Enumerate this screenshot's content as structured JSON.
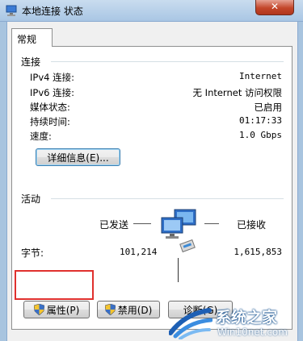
{
  "window": {
    "title": "本地连接 状态",
    "close_label": "✕"
  },
  "tab": {
    "label": "常规"
  },
  "connection": {
    "heading": "连接",
    "rows": [
      {
        "label": "IPv4 连接:",
        "value": "Internet"
      },
      {
        "label": "IPv6 连接:",
        "value": "无 Internet 访问权限"
      },
      {
        "label": "媒体状态:",
        "value": "已启用"
      },
      {
        "label": "持续时间:",
        "value": "01:17:33"
      },
      {
        "label": "速度:",
        "value": "1.0 Gbps"
      }
    ],
    "details_button": "详细信息(E)..."
  },
  "activity": {
    "heading": "活动",
    "sent_label": "已发送",
    "received_label": "已接收",
    "bytes_label": "字节:",
    "sent_value": "101,214",
    "received_value": "1,615,853"
  },
  "buttons": {
    "properties": "属性(P)",
    "disable": "禁用(D)",
    "diagnose": "诊断(G)"
  },
  "watermark": {
    "line1": "系统之家",
    "line2": "Win10net.com"
  },
  "colors": {
    "highlight": "#e0302d",
    "titlebar": "#b8d1ea"
  }
}
